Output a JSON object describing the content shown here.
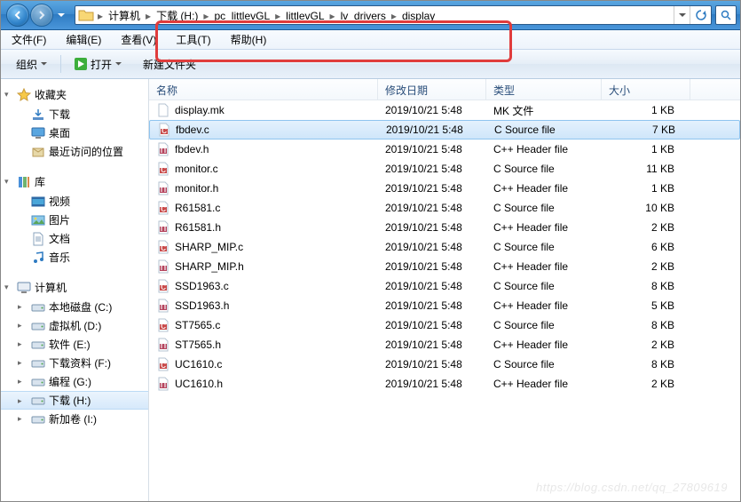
{
  "breadcrumbs": [
    "计算机",
    "下载 (H:)",
    "pc_littlevGL",
    "littlevGL",
    "lv_drivers",
    "display"
  ],
  "menu": {
    "file": "文件(F)",
    "edit": "编辑(E)",
    "view": "查看(V)",
    "tools": "工具(T)",
    "help": "帮助(H)"
  },
  "toolbar": {
    "organize": "组织",
    "open": "打开",
    "newfolder": "新建文件夹"
  },
  "sidebar": {
    "favorites": {
      "label": "收藏夹",
      "items": [
        {
          "icon": "download",
          "label": "下载"
        },
        {
          "icon": "desktop",
          "label": "桌面"
        },
        {
          "icon": "recent",
          "label": "最近访问的位置"
        }
      ]
    },
    "libraries": {
      "label": "库",
      "items": [
        {
          "icon": "video",
          "label": "视频"
        },
        {
          "icon": "pictures",
          "label": "图片"
        },
        {
          "icon": "documents",
          "label": "文档"
        },
        {
          "icon": "music",
          "label": "音乐"
        }
      ]
    },
    "computer": {
      "label": "计算机",
      "items": [
        {
          "icon": "drive",
          "label": "本地磁盘 (C:)"
        },
        {
          "icon": "drive",
          "label": "虚拟机 (D:)"
        },
        {
          "icon": "drive",
          "label": "软件 (E:)"
        },
        {
          "icon": "drive",
          "label": "下载资料 (F:)"
        },
        {
          "icon": "drive",
          "label": "编程 (G:)"
        },
        {
          "icon": "drive",
          "label": "下载 (H:)",
          "selected": true
        },
        {
          "icon": "drive",
          "label": "新加卷 (I:)"
        }
      ]
    }
  },
  "columns": {
    "name": "名称",
    "modified": "修改日期",
    "type": "类型",
    "size": "大小"
  },
  "col_widths": {
    "name": 258,
    "modified": 122,
    "type": 130,
    "size": 100
  },
  "files": [
    {
      "icon": "file",
      "name": "display.mk",
      "modified": "2019/10/21 5:48",
      "type": "MK 文件",
      "size": "1 KB"
    },
    {
      "icon": "c",
      "name": "fbdev.c",
      "modified": "2019/10/21 5:48",
      "type": "C Source file",
      "size": "7 KB",
      "selected": true
    },
    {
      "icon": "h",
      "name": "fbdev.h",
      "modified": "2019/10/21 5:48",
      "type": "C++ Header file",
      "size": "1 KB"
    },
    {
      "icon": "c",
      "name": "monitor.c",
      "modified": "2019/10/21 5:48",
      "type": "C Source file",
      "size": "11 KB"
    },
    {
      "icon": "h",
      "name": "monitor.h",
      "modified": "2019/10/21 5:48",
      "type": "C++ Header file",
      "size": "1 KB"
    },
    {
      "icon": "c",
      "name": "R61581.c",
      "modified": "2019/10/21 5:48",
      "type": "C Source file",
      "size": "10 KB"
    },
    {
      "icon": "h",
      "name": "R61581.h",
      "modified": "2019/10/21 5:48",
      "type": "C++ Header file",
      "size": "2 KB"
    },
    {
      "icon": "c",
      "name": "SHARP_MIP.c",
      "modified": "2019/10/21 5:48",
      "type": "C Source file",
      "size": "6 KB"
    },
    {
      "icon": "h",
      "name": "SHARP_MIP.h",
      "modified": "2019/10/21 5:48",
      "type": "C++ Header file",
      "size": "2 KB"
    },
    {
      "icon": "c",
      "name": "SSD1963.c",
      "modified": "2019/10/21 5:48",
      "type": "C Source file",
      "size": "8 KB"
    },
    {
      "icon": "h",
      "name": "SSD1963.h",
      "modified": "2019/10/21 5:48",
      "type": "C++ Header file",
      "size": "5 KB"
    },
    {
      "icon": "c",
      "name": "ST7565.c",
      "modified": "2019/10/21 5:48",
      "type": "C Source file",
      "size": "8 KB"
    },
    {
      "icon": "h",
      "name": "ST7565.h",
      "modified": "2019/10/21 5:48",
      "type": "C++ Header file",
      "size": "2 KB"
    },
    {
      "icon": "c",
      "name": "UC1610.c",
      "modified": "2019/10/21 5:48",
      "type": "C Source file",
      "size": "8 KB"
    },
    {
      "icon": "h",
      "name": "UC1610.h",
      "modified": "2019/10/21 5:48",
      "type": "C++ Header file",
      "size": "2 KB"
    }
  ],
  "watermark": "https://blog.csdn.net/qq_27809619"
}
